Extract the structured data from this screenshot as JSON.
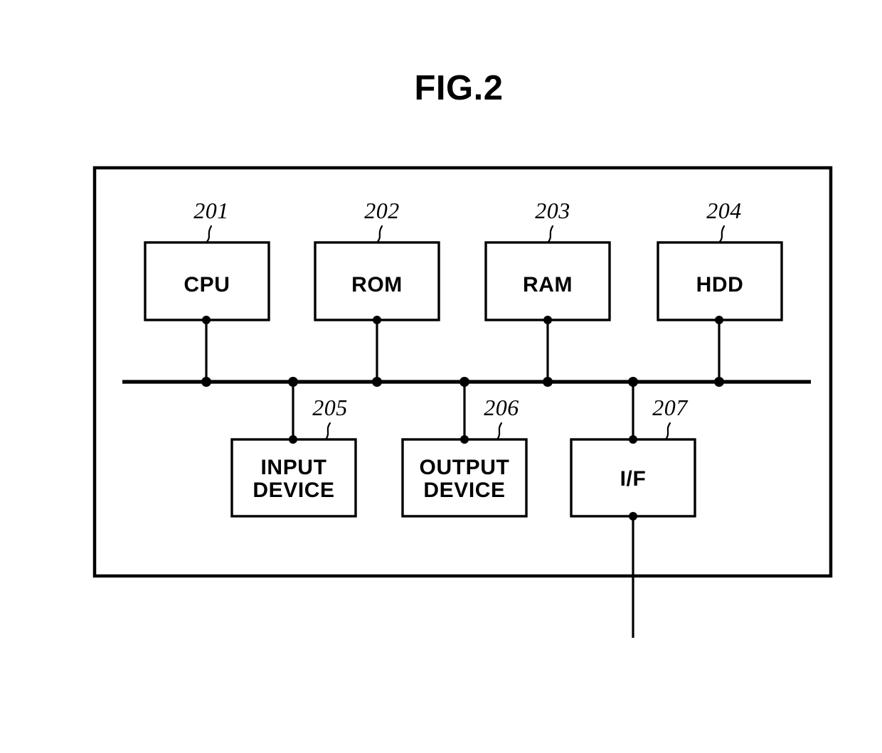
{
  "figure": {
    "title": "FIG.2",
    "type": "hardware-block-diagram"
  },
  "upper_units": [
    {
      "ref": "201",
      "label": "CPU"
    },
    {
      "ref": "202",
      "label": "ROM"
    },
    {
      "ref": "203",
      "label": "RAM"
    },
    {
      "ref": "204",
      "label": "HDD"
    }
  ],
  "lower_units": [
    {
      "ref": "205",
      "label_line1": "INPUT",
      "label_line2": "DEVICE"
    },
    {
      "ref": "206",
      "label_line1": "OUTPUT",
      "label_line2": "DEVICE"
    },
    {
      "ref": "207",
      "label_line1": "I/F",
      "label_line2": ""
    }
  ],
  "colors": {
    "ink": "#000000",
    "paper": "#ffffff"
  }
}
